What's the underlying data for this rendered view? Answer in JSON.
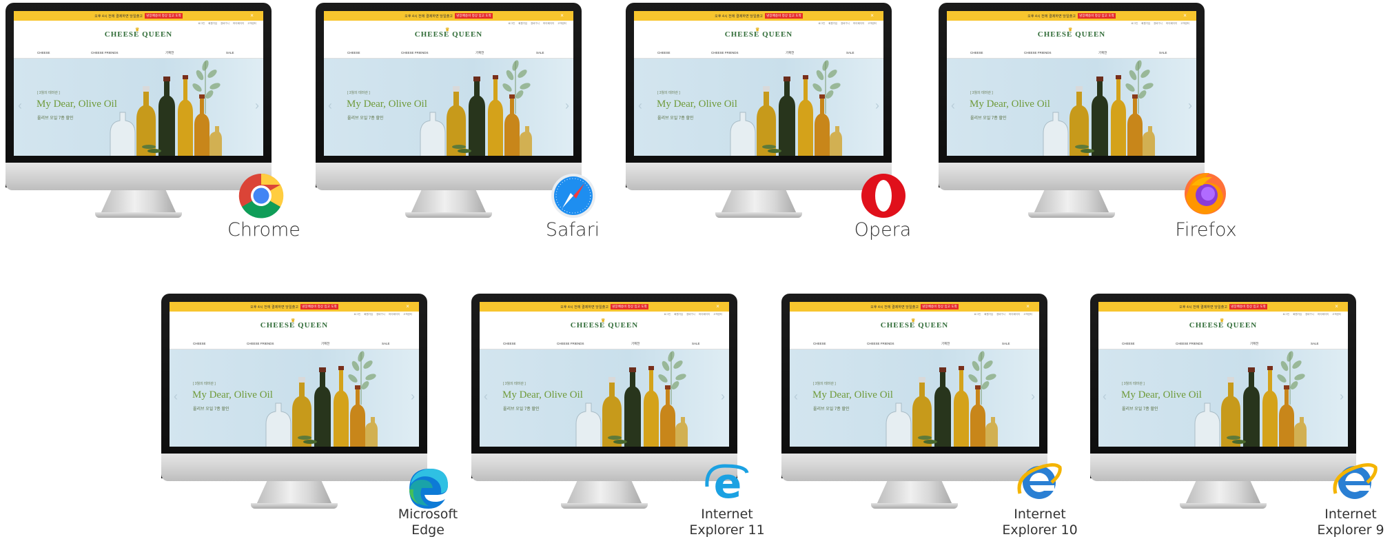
{
  "screen": {
    "promo_text": "오후 4시 전에 결제하면 당일출고",
    "promo_badge": "냉장배송비 정상 입고 도착",
    "close_label": "×",
    "util_links": [
      "로그인",
      "회원가입",
      "장바구니",
      "마이페이지",
      "고객센터"
    ],
    "logo": "CHEESE QUEEN",
    "nav": [
      "CHEESE",
      "CHEESE FRIENDS",
      "기획전",
      "SALE"
    ],
    "hero_tag": "[ 3월의 테마관 ]",
    "hero_title": "My Dear, Olive Oil",
    "hero_sub": "올리브 오일 7종 할인",
    "arrow_left": "‹",
    "arrow_right": "›"
  },
  "browsers": [
    {
      "name": "Chrome",
      "icon": "chrome-icon"
    },
    {
      "name": "Safari",
      "icon": "safari-icon"
    },
    {
      "name": "Opera",
      "icon": "opera-icon"
    },
    {
      "name": "Firefox",
      "icon": "firefox-icon"
    },
    {
      "name_line1": "Microsoft",
      "name_line2": "Edge",
      "icon": "edge-icon"
    },
    {
      "name_line1": "Internet",
      "name_line2": "Explorer 11",
      "icon": "ie11-icon"
    },
    {
      "name_line1": "Internet",
      "name_line2": "Explorer 10",
      "icon": "ie10-icon"
    },
    {
      "name_line1": "Internet",
      "name_line2": "Explorer 9",
      "icon": "ie9-icon"
    }
  ],
  "colors": {
    "promo_bar": "#f7c52e",
    "promo_badge": "#e62b2b",
    "logo_green": "#2f6b36",
    "hero_green": "#6f9a3a",
    "hero_bg": "#cfe3ee"
  }
}
